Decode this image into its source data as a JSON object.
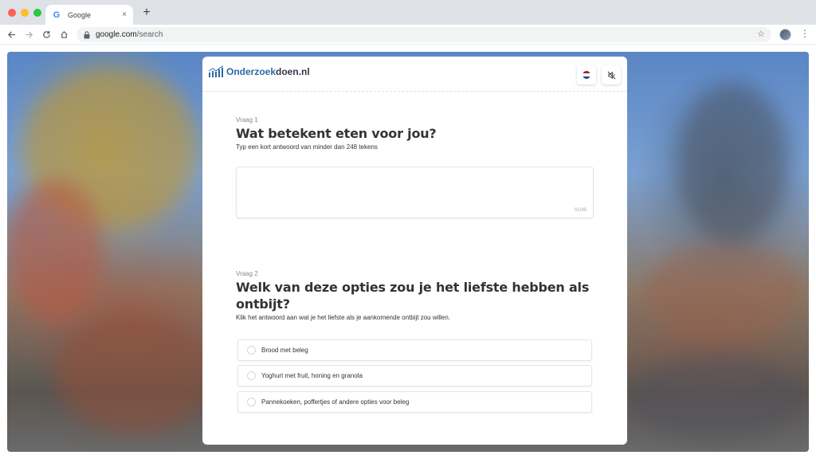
{
  "browser": {
    "tab_title": "Google",
    "tab_close": "×",
    "new_tab": "+",
    "url_host": "google.com",
    "url_path": "/search"
  },
  "survey": {
    "brand_part1": "Onderzoek",
    "brand_part2": "doen.nl",
    "language_flag": "dutch-flag-icon",
    "sound_toggle": "sound-off-icon",
    "question1": {
      "number": "Vraag 1",
      "title": "Wat betekent eten voor jou?",
      "hint": "Typ een kort antwoord van minder dan 248 tekens",
      "counter": "0/248"
    },
    "question2": {
      "number": "Vraag 2",
      "title": "Welk van deze opties zou je het liefste hebben als ontbijt?",
      "hint": "Klik het antwoord aan wat je het liefste als je aankomende ontbijt zou willen.",
      "options": [
        "Brood met beleg",
        "Yoghurt met fruit, honing en granola",
        "Pannekoeken, poffertjes of andere opties voor beleg"
      ]
    }
  },
  "colors": {
    "brand_blue": "#2b6aa8",
    "brand_dark": "#333a45",
    "flag_red": "#ae1c28",
    "flag_blue": "#21468b"
  }
}
